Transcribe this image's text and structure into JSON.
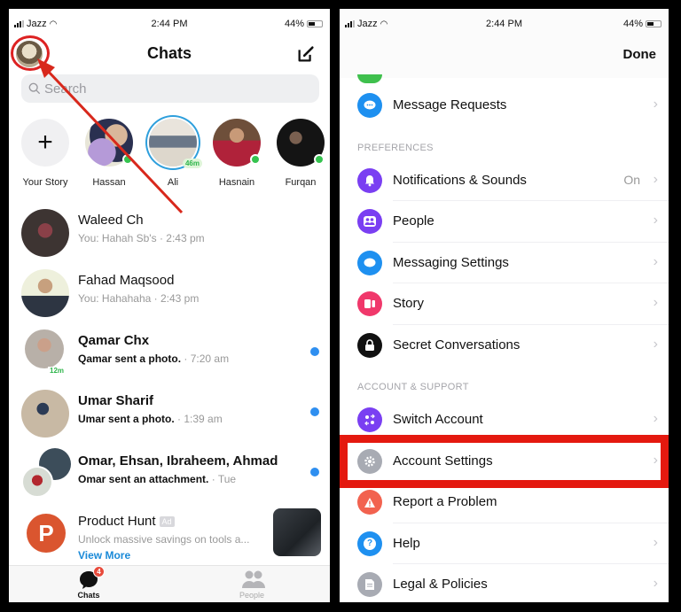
{
  "left_screen": {
    "status": {
      "carrier": "Jazz",
      "time": "2:44 PM",
      "battery": "44%"
    },
    "header": {
      "title": "Chats"
    },
    "search": {
      "placeholder": "Search"
    },
    "stories": [
      {
        "label": "Your Story",
        "type": "add"
      },
      {
        "label": "Hassan",
        "online": true
      },
      {
        "label": "Ali",
        "time": "46m"
      },
      {
        "label": "Hasnain",
        "online": true
      },
      {
        "label": "Furqan",
        "online": true
      }
    ],
    "chats": [
      {
        "name": "Waleed Ch",
        "preview": "You: Hahah Sb's",
        "time": "· 2:43 pm",
        "unread": false
      },
      {
        "name": "Fahad Maqsood",
        "preview": "You: Hahahaha",
        "time": "· 2:43 pm",
        "unread": false
      },
      {
        "name": "Qamar Chx",
        "preview": "Qamar sent a photo.",
        "time": "· 7:20 am",
        "unread": true,
        "active": "12m"
      },
      {
        "name": "Umar Sharif",
        "preview": "Umar sent a photo.",
        "time": "· 1:39 am",
        "unread": true
      },
      {
        "name": "Omar, Ehsan, Ibraheem, Ahmad",
        "preview": "Omar sent an attachment.",
        "time": "· Tue",
        "unread": true
      }
    ],
    "ad": {
      "name": "Product Hunt",
      "tag": "Ad",
      "text": "Unlock massive savings on tools a...",
      "cta": "View More",
      "logo_letter": "P"
    },
    "tabbar": {
      "chats": "Chats",
      "chats_badge": "4",
      "people": "People"
    }
  },
  "right_screen": {
    "status": {
      "carrier": "Jazz",
      "time": "2:44 PM",
      "battery": "44%"
    },
    "header": {
      "done": "Done"
    },
    "items": [
      {
        "label": "Message Requests",
        "icon": "message-requests-icon",
        "color": "#1e90f0"
      }
    ],
    "preferences_header": "PREFERENCES",
    "preferences": [
      {
        "label": "Notifications & Sounds",
        "value": "On",
        "icon": "bell-icon",
        "color": "#7a3ff2"
      },
      {
        "label": "People",
        "icon": "people-icon",
        "color": "#7a3ff2"
      },
      {
        "label": "Messaging Settings",
        "icon": "message-bubble-icon",
        "color": "#1e90f0"
      },
      {
        "label": "Story",
        "icon": "story-icon",
        "color": "#f0386b"
      },
      {
        "label": "Secret Conversations",
        "icon": "lock-icon",
        "color": "#111111"
      }
    ],
    "account_header": "ACCOUNT & SUPPORT",
    "account": [
      {
        "label": "Switch Account",
        "icon": "switch-account-icon",
        "color": "#7a3ff2"
      },
      {
        "label": "Account Settings",
        "icon": "gear-icon",
        "color": "#a8abb3",
        "highlighted": true
      },
      {
        "label": "Report a Problem",
        "icon": "warning-icon",
        "color": "#f2624f"
      },
      {
        "label": "Help",
        "icon": "help-icon",
        "color": "#1e90f0"
      },
      {
        "label": "Legal & Policies",
        "icon": "document-icon",
        "color": "#a8abb3"
      }
    ]
  },
  "annotations": {
    "highlight_color": "#e4190f"
  }
}
